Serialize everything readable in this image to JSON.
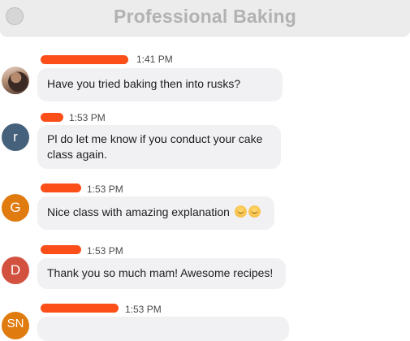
{
  "window": {
    "title": "Professional Baking"
  },
  "messages": [
    {
      "avatar_letter": "",
      "avatar_color": "#7a5a4a",
      "time": "1:41 PM",
      "text": "Have you tried baking then into rusks?"
    },
    {
      "avatar_letter": "r",
      "avatar_color": "#46617b",
      "time": "1:53 PM",
      "text": "Pl do let me know if you conduct your cake class again."
    },
    {
      "avatar_letter": "G",
      "avatar_color": "#e07b0f",
      "time": "1:53 PM",
      "text": "Nice class with amazing explanation"
    },
    {
      "avatar_letter": "D",
      "avatar_color": "#d2513f",
      "time": "1:53 PM",
      "text": "Thank you so much mam! Awesome recipes!"
    },
    {
      "avatar_letter": "SN",
      "avatar_color": "#e07b0f",
      "time": "1:53 PM",
      "text": ""
    }
  ],
  "colors": {
    "name_redaction": "#fc4e19",
    "bubble": "#f1f1f3",
    "title": "#b2b2b2"
  },
  "icons": {
    "emoji": "grinning-face-icon"
  }
}
